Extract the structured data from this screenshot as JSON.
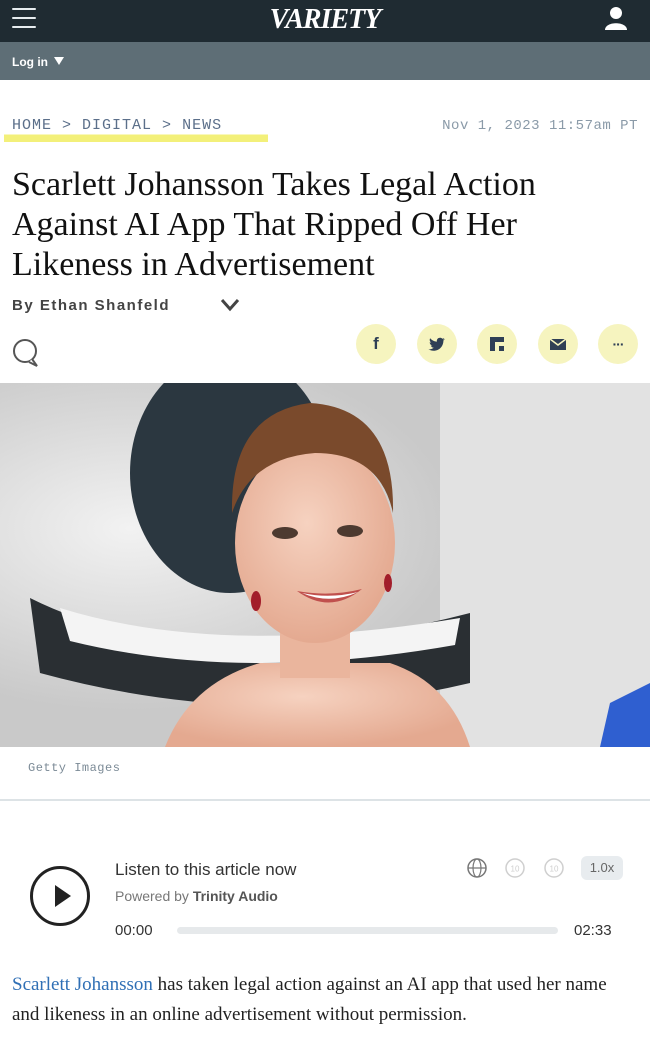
{
  "header": {
    "logo": "VARIETY",
    "menu_icon": "hamburger-menu-icon",
    "user_icon": "user-account-icon",
    "background": "#1f2b32"
  },
  "subnav": {
    "login_label": "Log in",
    "background": "#5e6e76"
  },
  "breadcrumb": {
    "items": [
      "HOME",
      ">",
      "DIGITAL",
      ">",
      "NEWS"
    ],
    "highlight_color": "#f3f07a"
  },
  "article": {
    "date": "Nov 1, 2023 11:57am PT",
    "headline": "Scarlett Johansson Takes Legal Action Against AI App That Ripped Off Her Likeness in Advertisement",
    "byline": "By Ethan Shanfeld",
    "image_caption": "Getty Images",
    "body_link": "Scarlett Johansson",
    "body_rest": " has taken legal action against an AI app that used her name and likeness in an online advertisement without permission."
  },
  "share": {
    "icons": [
      "comment-icon",
      "facebook-icon",
      "twitter-icon",
      "flipboard-icon",
      "email-icon",
      "more-icon"
    ],
    "button_color": "#f6f4bf",
    "facebook_glyph": "f",
    "more_glyph": "···"
  },
  "audio": {
    "title": "Listen to this article now",
    "powered_prefix": "Powered by",
    "powered_brand": "Trinity Audio",
    "current_time": "00:00",
    "duration": "02:33",
    "speed": "1.0x",
    "progress": 0
  }
}
